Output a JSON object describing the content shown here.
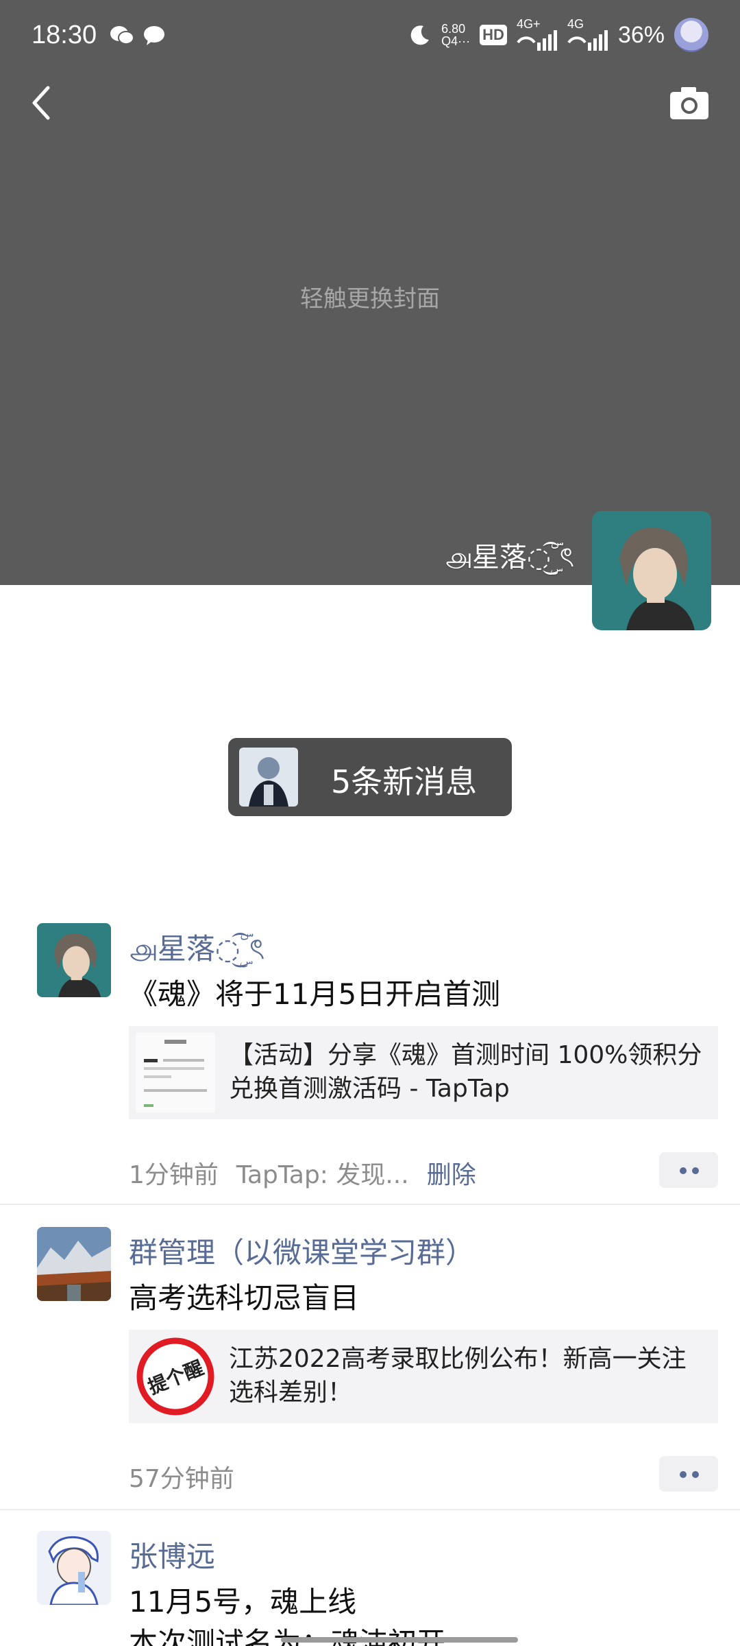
{
  "status_bar": {
    "time": "18:30",
    "net_speed_top": "6.80",
    "net_speed_bottom": "Q4···",
    "hd_label": "HD",
    "sim1_label": "4G+",
    "sim2_label": "4G",
    "battery": "36%"
  },
  "cover": {
    "hint": "轻触更换封面"
  },
  "profile": {
    "name": "௮星落◌ۣۜۜ͜͡ ৎ"
  },
  "new_messages": {
    "label": "5条新消息"
  },
  "posts": [
    {
      "author": "௮星落◌ۣۜۜ͜͡ ৎ",
      "text": "《魂》将于11月5日开启首测",
      "link_title": "【活动】分享《魂》首测时间 100%领积分兑换首测激活码 - TapTap",
      "time": "1分钟前",
      "source": "TapTap: 发现...",
      "delete_label": "删除"
    },
    {
      "author": "群管理（以微课堂学习群）",
      "text": "高考选科切忌盲目",
      "link_title": "江苏2022高考录取比例公布！新高一关注选科差别！",
      "thumb_text": "提个醒",
      "time": "57分钟前"
    },
    {
      "author": "张博远",
      "text_line1": "11月5号，魂上线",
      "text_line2": "本次测试名为：魂沌初开"
    }
  ],
  "colors": {
    "cover_bg": "#5b5b5b",
    "link_blue": "#576b95",
    "badge_bg": "#4d4d4d"
  }
}
